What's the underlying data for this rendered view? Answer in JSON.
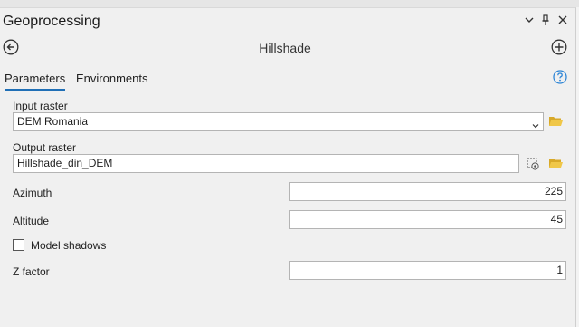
{
  "pane": {
    "title": "Geoprocessing",
    "menu_icon": "chevron-down-icon",
    "pin_icon": "pin-icon",
    "close_icon": "close-icon",
    "close_glyph": "✕",
    "pin_glyph": "📌"
  },
  "tool": {
    "title": "Hillshade",
    "back_icon": "back-arrow-icon",
    "add_icon": "add-icon"
  },
  "tabs": [
    {
      "label": "Parameters",
      "active": true
    },
    {
      "label": "Environments",
      "active": false
    }
  ],
  "help_icon": "help-icon",
  "params": {
    "input_raster": {
      "label": "Input raster",
      "value": "DEM Romania"
    },
    "output_raster": {
      "label": "Output raster",
      "value": "Hillshade_din_DEM"
    },
    "azimuth": {
      "label": "Azimuth",
      "value": "225"
    },
    "altitude": {
      "label": "Altitude",
      "value": "45"
    },
    "model_shadows": {
      "label": "Model shadows",
      "checked": false
    },
    "z_factor": {
      "label": "Z factor",
      "value": "1"
    }
  },
  "colors": {
    "accent": "#1f6fb6",
    "folder": "#d8a929",
    "help": "#2f86d6"
  }
}
